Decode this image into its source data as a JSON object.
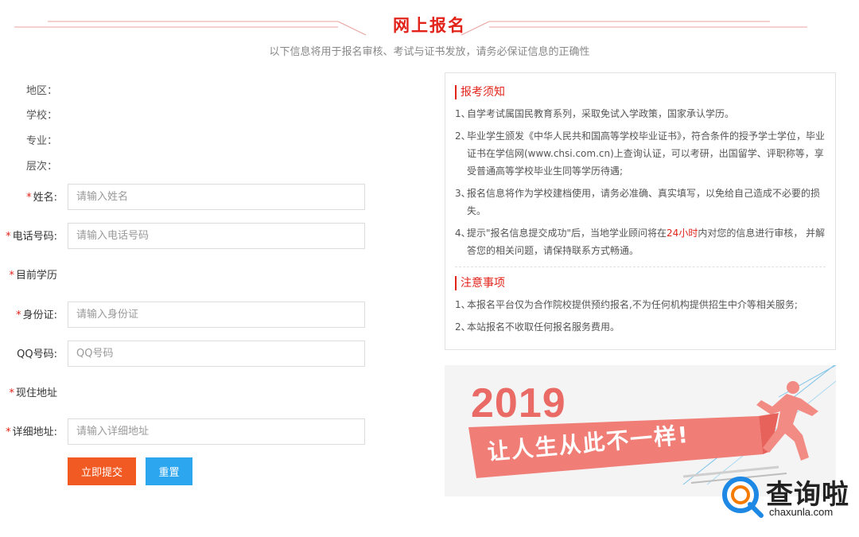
{
  "header": {
    "title": "网上报名",
    "subtitle": "以下信息将用于报名审核、考试与证书发放，请务必保证信息的正确性"
  },
  "form": {
    "region_label": "地区：",
    "school_label": "学校：",
    "major_label": "专业：",
    "level_label": "层次：",
    "required_mark": "*",
    "name": {
      "label": "姓名:",
      "placeholder": "请输入姓名"
    },
    "phone": {
      "label": "电话号码:",
      "placeholder": "请输入电话号码"
    },
    "education_label": "目前学历",
    "id_card": {
      "label": "身份证:",
      "placeholder": "请输入身份证"
    },
    "qq": {
      "label": "QQ号码:",
      "placeholder": "QQ号码"
    },
    "residence_label": "现住地址",
    "address": {
      "label": "详细地址:",
      "placeholder": "请输入详细地址"
    },
    "submit_label": "立即提交",
    "reset_label": "重置"
  },
  "notice": {
    "title1": "报考须知",
    "items": [
      {
        "num": "1、",
        "text": "自学考试属国民教育系列，采取免试入学政策，国家承认学历。"
      },
      {
        "num": "2、",
        "text": "毕业学生颁发《中华人民共和国高等学校毕业证书》，符合条件的授予学士学位，毕业证书在学信网(www.chsi.com.cn)上查询认证，可以考研，出国留学、评职称等，享受普通高等学校毕业生同等学历待遇;"
      },
      {
        "num": "3、",
        "text": "报名信息将作为学校建档使用，请务必准确、真实填写，以免给自己造成不必要的损失。"
      },
      {
        "num": "4、",
        "text_before": "提示\"报名信息提交成功\"后，当地学业顾问将在",
        "highlight": "24小时",
        "text_after": "内对您的信息进行审核， 并解答您的相关问题，请保持联系方式畅通。"
      }
    ],
    "title2": "注意事项",
    "items2": [
      {
        "num": "1、",
        "text": "本报名平台仅为合作院校提供预约报名,不为任何机构提供招生中介等相关服务;"
      },
      {
        "num": "2、",
        "text": "本站报名不收取任何报名服务费用。"
      }
    ]
  },
  "banner": {
    "year": "2019",
    "slogan": "让人生从此不一样!",
    "colors": {
      "main": "#ea6a65",
      "ribbon": "#f07e77"
    }
  },
  "watermark": {
    "text": "查询啦",
    "domain": "chaxunla.com",
    "icon": "magnifier-q-icon"
  },
  "colors": {
    "accent": "#e2231a",
    "submit": "#f15a22",
    "reset": "#2da6f0"
  }
}
